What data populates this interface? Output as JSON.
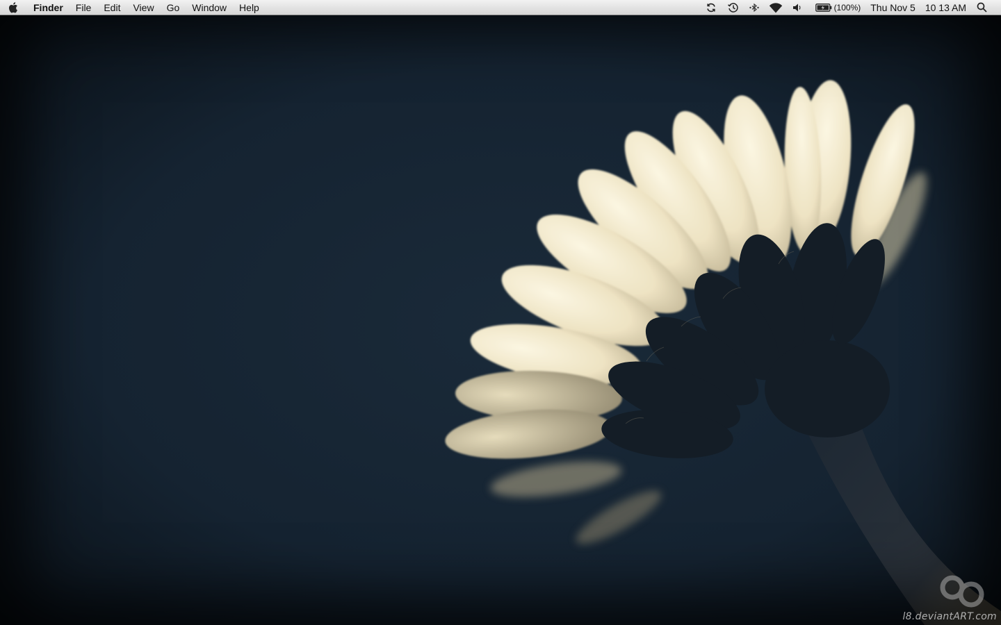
{
  "menubar": {
    "app_name": "Finder",
    "menus": [
      "File",
      "Edit",
      "View",
      "Go",
      "Window",
      "Help"
    ],
    "status_icons": [
      "sync-icon",
      "time-machine-icon",
      "bluetooth-icon",
      "wifi-icon",
      "volume-icon"
    ],
    "battery": {
      "icon": "battery-charging-icon",
      "percent_label": "(100%)"
    },
    "date": "Thu Nov 5",
    "time": "10 13 AM",
    "spotlight_icon": "spotlight-icon"
  },
  "desktop": {
    "wallpaper": "daisy-flower-wallpaper",
    "watermark": "l8.deviantART.com",
    "colors": {
      "background": "#152331",
      "petal": "#f3ebcf",
      "sepal": "#141d26"
    }
  }
}
